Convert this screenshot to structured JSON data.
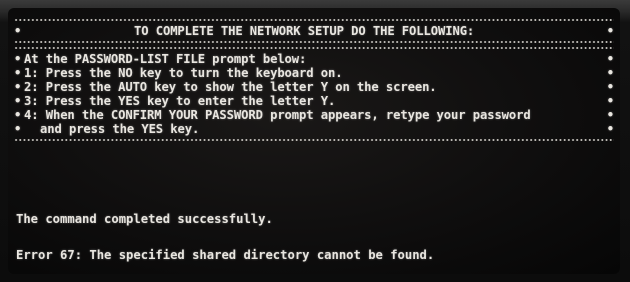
{
  "terminal": {
    "title": "TO COMPLETE THE NETWORK SETUP DO THE FOLLOWING:",
    "bullet": "•",
    "lines": [
      "At the PASSWORD-LIST FILE prompt below:",
      "1: Press the NO key to turn the keyboard on.",
      "2: Press the AUTO key to show the letter Y on the screen.",
      "3: Press the YES key to enter the letter Y.",
      "4: When the CONFIRM YOUR PASSWORD prompt appears, retype your password",
      "and press the YES key."
    ],
    "status_message": "The command completed successfully.",
    "error_message": "Error 67: The specified shared directory cannot be found."
  }
}
